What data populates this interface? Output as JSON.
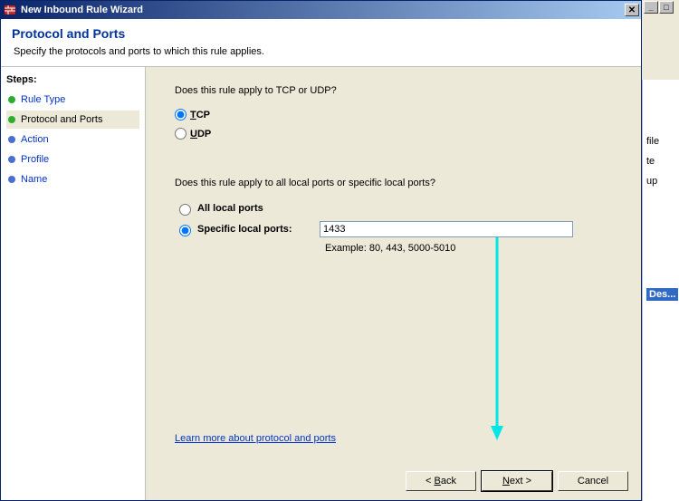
{
  "titlebar": {
    "title": "New Inbound Rule Wizard"
  },
  "header": {
    "title": "Protocol and Ports",
    "subtitle": "Specify the protocols and ports to which this rule applies."
  },
  "steps": {
    "heading": "Steps:",
    "items": [
      {
        "label": "Rule Type",
        "state": "done"
      },
      {
        "label": "Protocol and Ports",
        "state": "current"
      },
      {
        "label": "Action",
        "state": "todo"
      },
      {
        "label": "Profile",
        "state": "todo"
      },
      {
        "label": "Name",
        "state": "todo"
      }
    ]
  },
  "form": {
    "protocol_question": "Does this rule apply to TCP or UDP?",
    "tcp_prefix": "T",
    "tcp_rest": "CP",
    "udp_prefix": "U",
    "udp_rest": "DP",
    "ports_question": "Does this rule apply to all local ports or specific local ports?",
    "all_ports_prefix": "A",
    "all_ports_rest": "ll local ports",
    "specific_ports_prefix": "S",
    "specific_ports_rest": "pecific local ports:",
    "port_value": "1433",
    "example_text": "Example: 80, 443, 5000-5010",
    "learn_more": "Learn more about protocol and ports"
  },
  "buttons": {
    "back_lt": "< ",
    "back_u": "B",
    "back_rest": "ack",
    "next_u": "N",
    "next_rest": "ext >",
    "cancel": "Cancel"
  },
  "background": {
    "item_file": "file",
    "item_te": "te",
    "item_up": "up",
    "selected": "Des..."
  }
}
